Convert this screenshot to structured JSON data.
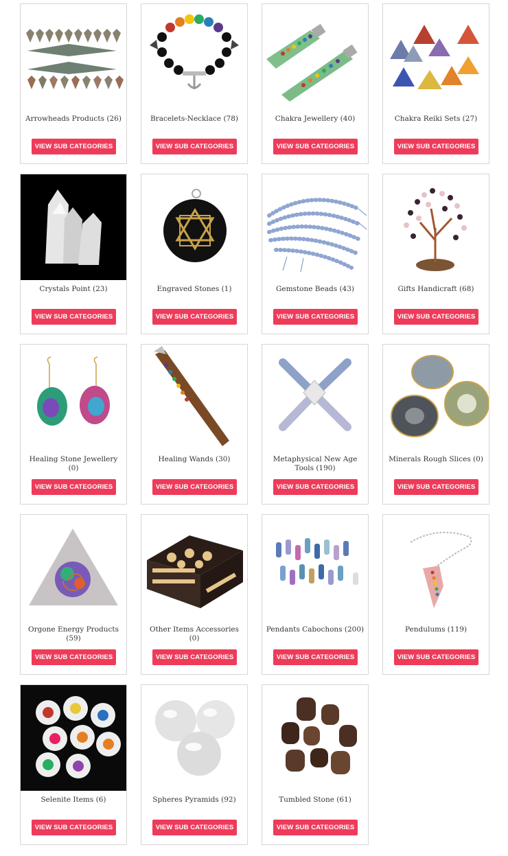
{
  "button_label": "VIEW SUB CATEGORIES",
  "accent_color": "#ee3b5a",
  "categories": [
    {
      "name": "Arrowheads Products (26)",
      "icon": "arrowheads-image"
    },
    {
      "name": "Bracelets-Necklace (78)",
      "icon": "bracelet-image"
    },
    {
      "name": "Chakra Jewellery (40)",
      "icon": "chakra-pendant-image"
    },
    {
      "name": "Chakra Reiki Sets (27)",
      "icon": "reiki-pyramids-image"
    },
    {
      "name": "Crystals Point (23)",
      "icon": "crystal-points-image"
    },
    {
      "name": "Engraved Stones (1)",
      "icon": "engraved-pendant-image"
    },
    {
      "name": "Gemstone Beads (43)",
      "icon": "bead-strands-image"
    },
    {
      "name": "Gifts Handicraft (68)",
      "icon": "gem-tree-image"
    },
    {
      "name": "Healing Stone Jewellery (0)",
      "icon": "druzy-earrings-image"
    },
    {
      "name": "Healing Wands (30)",
      "icon": "healing-wand-image"
    },
    {
      "name": "Metaphysical New Age Tools (190)",
      "icon": "energy-tool-image"
    },
    {
      "name": "Minerals Rough Slices (0)",
      "icon": "agate-slices-image"
    },
    {
      "name": "Orgone Energy Products (59)",
      "icon": "orgone-pyramid-image"
    },
    {
      "name": "Other Items Accessories (0)",
      "icon": "wooden-box-image"
    },
    {
      "name": "Pendants Cabochons (200)",
      "icon": "pendants-image"
    },
    {
      "name": "Pendulums (119)",
      "icon": "pendulum-image"
    },
    {
      "name": "Selenite Items (6)",
      "icon": "selenite-plates-image"
    },
    {
      "name": "Spheres Pyramids (92)",
      "icon": "spheres-image"
    },
    {
      "name": "Tumbled Stone (61)",
      "icon": "tumbled-stones-image"
    }
  ]
}
